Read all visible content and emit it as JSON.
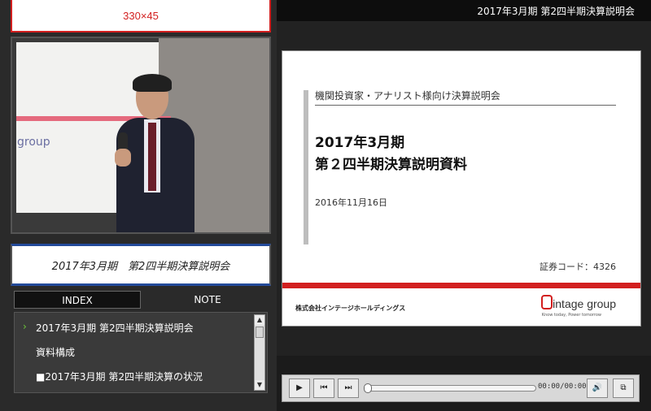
{
  "banner": {
    "text": "330×45"
  },
  "video": {
    "slide_text_faded": "",
    "slide_text_group": "group"
  },
  "session_title": "2017年3月期　第2四半期決算説明会",
  "tabs": {
    "index": "INDEX",
    "note": "NOTE"
  },
  "index_items": [
    {
      "label": "2017年3月期 第2四半期決算説明会",
      "current": true
    },
    {
      "label": "資料構成",
      "current": false
    },
    {
      "label": "■2017年3月期 第2四半期決算の状況",
      "current": false
    }
  ],
  "top_title": "2017年3月期 第2四半期決算説明会",
  "slide": {
    "subtitle": "機関投資家・アナリスト様向け決算説明会",
    "title_line1": "2017年3月期",
    "title_line2": "第２四半期決算説明資料",
    "date": "2016年11月16日",
    "stock_code": "証券コード：4326",
    "company": "株式会社インテージホールディングス",
    "logo_text": "intage group",
    "logo_tagline": "Know today, Power tomorrow"
  },
  "player": {
    "time": "00:00/00:00",
    "progress": 0,
    "buttons": {
      "play": "▶",
      "prev": "⏮",
      "next": "⏭",
      "volume": "🔊",
      "fullscreen": "⧉"
    }
  },
  "colors": {
    "accent_red": "#d21f1f",
    "index_arrow": "#6ec83a",
    "title_rule": "#234a9a"
  }
}
